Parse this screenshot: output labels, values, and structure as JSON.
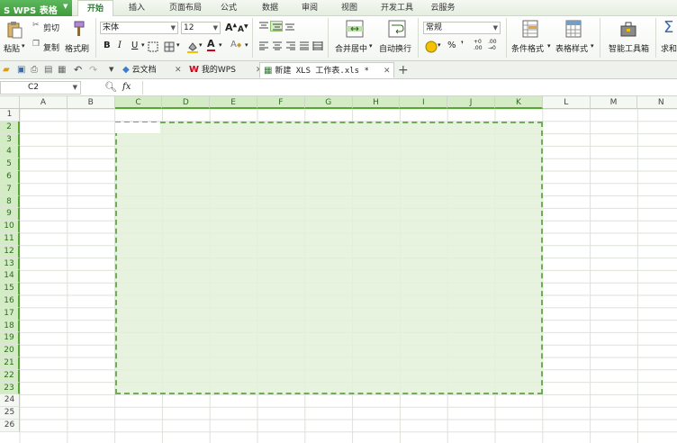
{
  "app": {
    "name": "WPS 表格"
  },
  "menu_tabs": [
    "开始",
    "插入",
    "页面布局",
    "公式",
    "数据",
    "审阅",
    "视图",
    "开发工具",
    "云服务"
  ],
  "ribbon": {
    "paste": "粘贴",
    "cut": "剪切",
    "copy": "复制",
    "format_painter": "格式刷",
    "font_name": "宋体",
    "font_size": "12",
    "bold": "B",
    "italic": "I",
    "underline": "U",
    "merge_center": "合并居中",
    "wrap_text": "自动换行",
    "number_format": "常规",
    "percent": "%",
    "conditional_format": "条件格式",
    "table_style": "表格样式",
    "smart_toolbox": "智能工具箱",
    "sum": "求和"
  },
  "doc_tabs": [
    {
      "label": "云文档"
    },
    {
      "label": "我的WPS"
    },
    {
      "label": "新建 XLS 工作表.xls *"
    }
  ],
  "formula": {
    "name_box": "C2",
    "fx": "fx",
    "content": ""
  },
  "columns": [
    "A",
    "B",
    "C",
    "D",
    "E",
    "F",
    "G",
    "H",
    "I",
    "J",
    "K",
    "L",
    "M",
    "N"
  ],
  "rows": [
    "1",
    "2",
    "3",
    "4",
    "5",
    "6",
    "7",
    "8",
    "9",
    "10",
    "11",
    "12",
    "13",
    "14",
    "15",
    "16",
    "17",
    "18",
    "19",
    "20",
    "21",
    "22",
    "23",
    "24",
    "25",
    "26"
  ],
  "selection": {
    "range": "C2:K23",
    "active_cell": "C2",
    "copy_marquee": true
  },
  "colors": {
    "accent": "#3f9a3a",
    "selection_fill": "#e3f2d9",
    "selection_border": "#5a9f3e"
  }
}
